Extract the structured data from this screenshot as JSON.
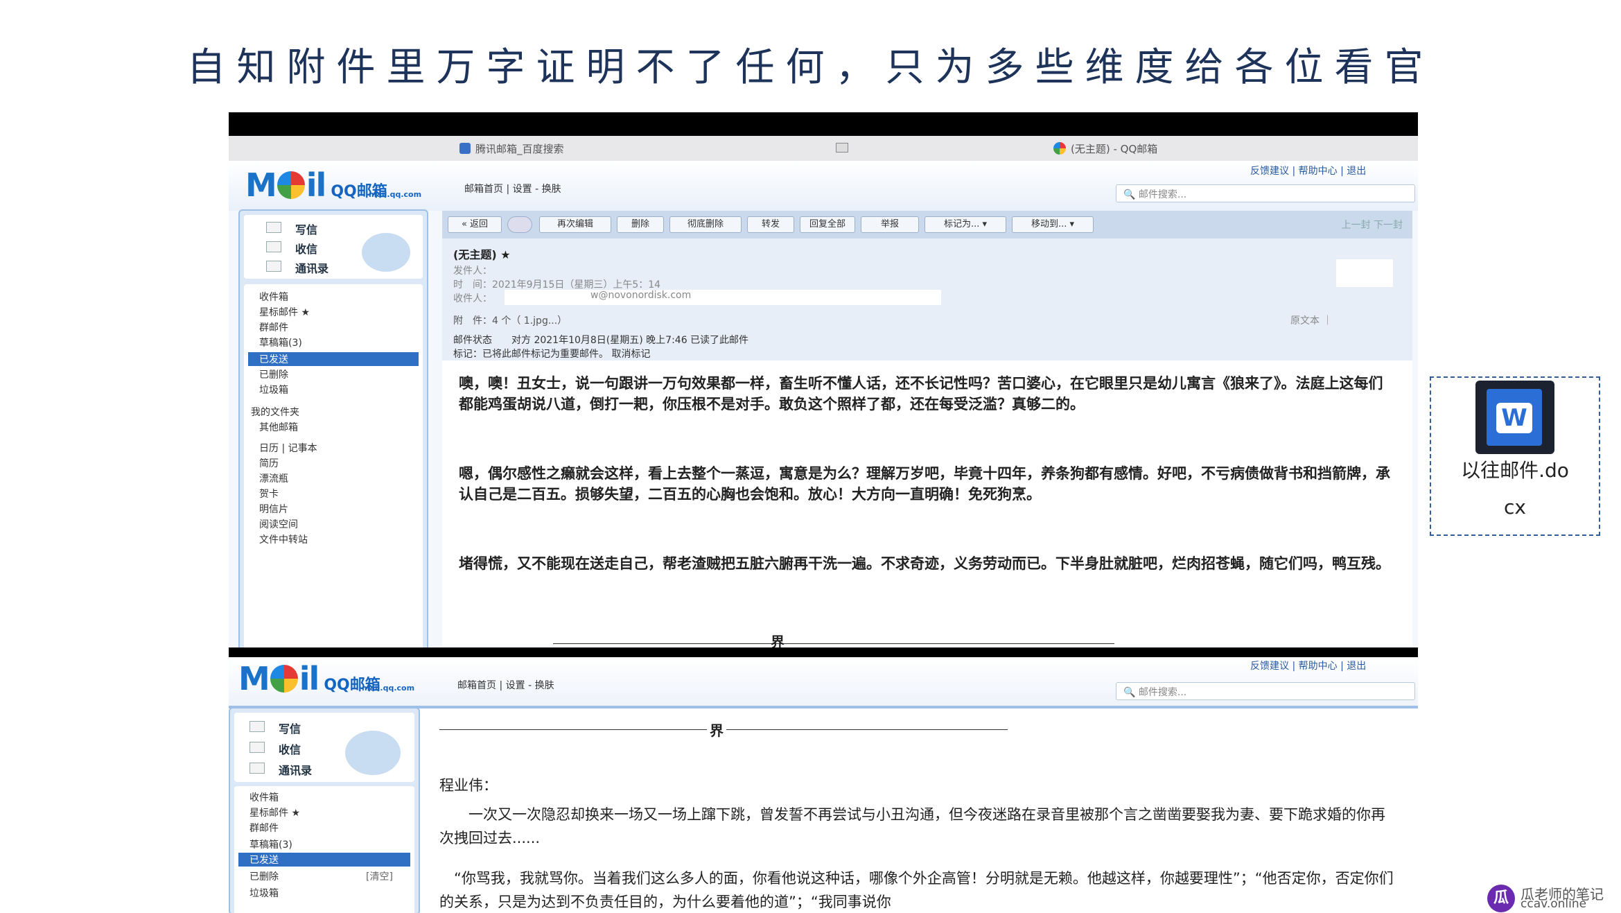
{
  "slide": {
    "title": "自知附件里万字证明不了任何，只为多些维度给各位看官"
  },
  "shot1": {
    "tab_left": "腾讯邮箱_百度搜索",
    "tab_right": "(无主题) - QQ邮箱",
    "logo_main": "M",
    "logo_il": "il",
    "logo_qq": "QQ邮箱",
    "logo_sub": "mail.qq.com",
    "nav": "邮箱首页 | 设置 - 换肤",
    "toplinks": "反馈建议 | 帮助中心 | 退出",
    "search_placeholder": "邮件搜索...",
    "side_top": [
      "写信",
      "收信",
      "通讯录"
    ],
    "folders": [
      "收件箱",
      "星标邮件 ★",
      "群邮件",
      "草稿箱(3)",
      "已发送",
      "已删除",
      "垃圾箱",
      "我的文件夹",
      "其他邮箱",
      "日历 | 记事本",
      "简历",
      "漂流瓶",
      "贺卡",
      "明信片",
      "阅读空间",
      "文件中转站"
    ],
    "toolbar": [
      "« 返回",
      "",
      "再次编辑",
      "删除",
      "彻底删除",
      "转发",
      "回复全部",
      "举报",
      "标记为... ▾",
      "移动到... ▾"
    ],
    "pager": "上一封 下一封",
    "subject": "(无主题) ★",
    "hdr_from": "发件人：",
    "hdr_time": "时　间：2021年9月15日（星期三）上午5：14",
    "hdr_to": "收件人：",
    "hdr_to_val": "w@novonordisk.com",
    "hdr_att": "附　件：4 个（ 1.jpg...）",
    "hdr_right": "原文本 ｜",
    "hdr_note1": "邮件状态　　对方 2021年10月8日(星期五) 晚上7:46 已读了此邮件",
    "hdr_note2": "标记：已将此邮件标记为重要邮件。 取消标记",
    "para1": "噢，噢！丑女士，说一句跟讲一万句效果都一样，畜生听不懂人话，还不长记性吗？苦口婆心，在它眼里只是幼儿寓言《狼来了》。法庭上这每们都能鸡蛋胡说八道，倒打一耙，你压根不是对手。敢负这个照样了都，还在每受泛滥？真够二的。",
    "para2": "嗯，偶尔感性之癞就会这样，看上去整个一蒸逗，寓意是为么？理解万岁吧，毕竟十四年，养条狗都有感情。好吧，不亏病债做背书和挡箭牌，承认自己是二百五。损够失望，二百五的心胸也会饱和。放心！大方向一直明确！免死狗烹。",
    "para3": "堵得慌，又不能现在送走自己，帮老渣贼把五脏六腑再干洗一遍。不求奇迹，义务劳动而已。下半身肚就脏吧，烂肉招苍蝇，随它们吗，鸭互残。",
    "divider_label": "界"
  },
  "shot2": {
    "logo_main": "M",
    "logo_il": "il",
    "logo_qq": "QQ邮箱",
    "logo_sub": "mail.qq.com",
    "nav": "邮箱首页 | 设置 - 换肤",
    "toplinks": "反馈建议 | 帮助中心 | 退出",
    "search_placeholder": "邮件搜索...",
    "side_top": [
      "写信",
      "收信",
      "通讯录"
    ],
    "folders": [
      "收件箱",
      "星标邮件 ★",
      "群邮件",
      "草稿箱(3)",
      "已发送",
      "已删除",
      "垃圾箱"
    ],
    "clear_label": "[清空]",
    "divider_label": "界",
    "salutation": "程业伟：",
    "para1": "　　一次又一次隐忍却换来一场又一场上蹿下跳，曾发誓不再尝试与小丑沟通，但今夜迷路在录音里被那个言之凿凿要娶我为妻、要下跪求婚的你再次拽回过去......",
    "para2": "　“你骂我，我就骂你。当着我们这么多人的面，你看他说这种话，哪像个外企高管！分明就是无赖。他越这样，你越要理性”；“他否定你，否定你们的关系，只是为达到不负责任目的，为什么要着他的道”；“我同事说你"
  },
  "attachment": {
    "icon": "word-document-icon",
    "name_line1": "以往邮件.do",
    "name_line2": "cx"
  },
  "watermark": {
    "text1": "瓜老师的笔记",
    "text2": "ccav.online"
  },
  "colors": {
    "title": "#1d3359",
    "accent": "#2f6fc4",
    "sidebar": "#dde8f6"
  }
}
